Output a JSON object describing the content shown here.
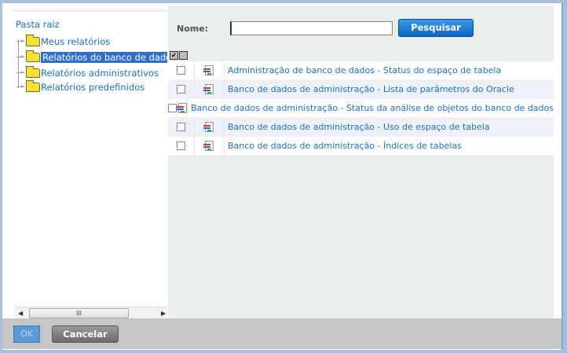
{
  "tree": {
    "root": "Pasta raiz",
    "items": [
      {
        "label": "Meus relatórios"
      },
      {
        "label": "Relatórios do banco de dados adm"
      },
      {
        "label": "Relatórios administrativos"
      },
      {
        "label": "Relatórios predefinidos"
      }
    ],
    "scroll_grip": "III"
  },
  "search": {
    "label": "Nome:",
    "value": "",
    "button": "Pesquisar"
  },
  "reports": [
    "Administração de banco de dados - Status do espaço de tabela",
    "Banco de dados de administração - Lista de parâmetros do Oracle",
    "Banco de dados de administração - Status da análise de objetos do banco de dados",
    "Banco de dados de administração - Uso de espaço de tabela",
    "Banco de dados de administração - Índices de tabelas"
  ],
  "footer": {
    "ok": "OK",
    "cancel": "Cancelar"
  }
}
